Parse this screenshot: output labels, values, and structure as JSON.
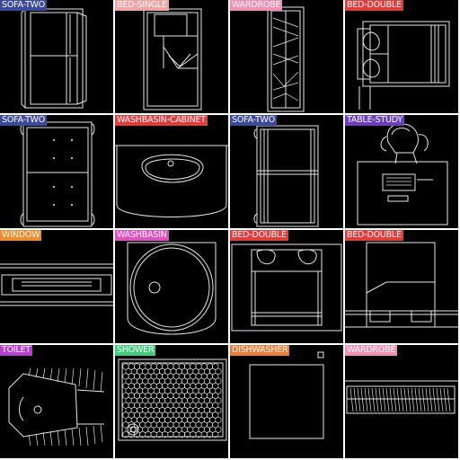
{
  "tiles": [
    {
      "label": "SOFA-TWO",
      "color": "#3b4a9a"
    },
    {
      "label": "BED-SINGLE",
      "color": "#f2a3a3"
    },
    {
      "label": "WARDROBE",
      "color": "#f28fb5"
    },
    {
      "label": "BED-DOUBLE",
      "color": "#e23c3c"
    },
    {
      "label": "SOFA-TWO",
      "color": "#3b4a9a"
    },
    {
      "label": "WASHBASIN-CABINET",
      "color": "#e23c3c"
    },
    {
      "label": "SOFA-TWO",
      "color": "#3b4a9a"
    },
    {
      "label": "TABLE-STUDY",
      "color": "#6a3fc2"
    },
    {
      "label": "WINDOW",
      "color": "#f08a2b"
    },
    {
      "label": "WASHBASIN",
      "color": "#e24fc0"
    },
    {
      "label": "BED-DOUBLE",
      "color": "#e23c3c"
    },
    {
      "label": "BED-DOUBLE",
      "color": "#e23c3c"
    },
    {
      "label": "TOILET",
      "color": "#b43fd0"
    },
    {
      "label": "SHOWER",
      "color": "#3fcf7a"
    },
    {
      "label": "DISHWASHER",
      "color": "#f07d3a"
    },
    {
      "label": "WARDROBE",
      "color": "#f28fb5"
    }
  ]
}
